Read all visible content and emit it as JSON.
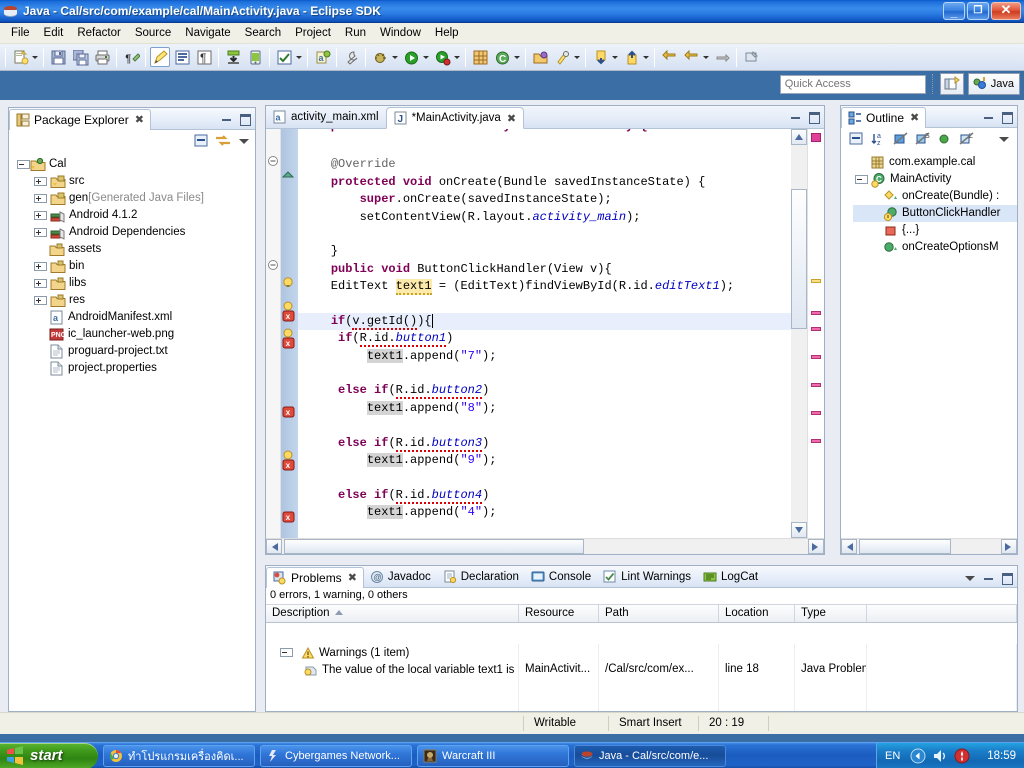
{
  "window": {
    "title": "Java - Cal/src/com/example/cal/MainActivity.java - Eclipse SDK",
    "app_icon": "eclipse-icon",
    "minimize_glyph": "_",
    "maximize_glyph": "❐",
    "close_glyph": "✕"
  },
  "menu": {
    "items": [
      "File",
      "Edit",
      "Refactor",
      "Source",
      "Navigate",
      "Search",
      "Project",
      "Run",
      "Window",
      "Help"
    ]
  },
  "toolbar": {
    "icons": [
      "new-wizard-icon",
      "save-icon",
      "save-all-icon",
      "print-icon",
      "annotation-icon",
      "edit-pencil-icon",
      "toggle-block-selection-icon",
      "show-whitespace-icon",
      "android-sdk-manager-icon",
      "android-avd-manager-icon",
      "lint-check-icon",
      "new-android-project-icon",
      "external-tools-icon",
      "debug-icon",
      "run-icon",
      "coverage-icon",
      "new-java-package-icon",
      "new-java-class-icon",
      "open-type-icon",
      "search-icon",
      "next-annotation-icon",
      "previous-annotation-icon",
      "last-edit-location-icon",
      "back-icon",
      "forward-icon",
      "pin-editor-icon"
    ]
  },
  "quick_access": {
    "placeholder": "Quick Access",
    "value": "",
    "new-perspective-icon": "new-perspective-icon",
    "perspective_label": "Java",
    "perspective_icon": "java-perspective-icon"
  },
  "package_explorer": {
    "title": "Package Explorer",
    "close_glyph": "✖",
    "toolbar_icons": [
      "collapse-all-icon",
      "link-with-editor-icon",
      "view-menu-icon"
    ],
    "tree": [
      {
        "label": "Cal",
        "icon": "java-project-icon",
        "toggle": "minus",
        "depth": 0,
        "dim": ""
      },
      {
        "label": "src",
        "icon": "source-folder-icon",
        "toggle": "plus",
        "depth": 1,
        "dim": ""
      },
      {
        "label": "gen",
        "icon": "source-folder-icon",
        "toggle": "plus",
        "depth": 1,
        "dim": " [Generated Java Files]"
      },
      {
        "label": "Android 4.1.2",
        "icon": "library-icon",
        "toggle": "plus",
        "depth": 1,
        "dim": ""
      },
      {
        "label": "Android Dependencies",
        "icon": "library-icon",
        "toggle": "plus",
        "depth": 1,
        "dim": ""
      },
      {
        "label": "assets",
        "icon": "folder-icon",
        "toggle": "none",
        "depth": 1,
        "dim": ""
      },
      {
        "label": "bin",
        "icon": "folder-icon",
        "toggle": "plus",
        "depth": 1,
        "dim": ""
      },
      {
        "label": "libs",
        "icon": "folder-icon",
        "toggle": "plus",
        "depth": 1,
        "dim": ""
      },
      {
        "label": "res",
        "icon": "folder-icon",
        "toggle": "plus",
        "depth": 1,
        "dim": ""
      },
      {
        "label": "AndroidManifest.xml",
        "icon": "xml-file-icon",
        "toggle": "none",
        "depth": 1,
        "dim": ""
      },
      {
        "label": "ic_launcher-web.png",
        "icon": "png-file-icon",
        "toggle": "none",
        "depth": 1,
        "dim": ""
      },
      {
        "label": "proguard-project.txt",
        "icon": "text-file-icon",
        "toggle": "none",
        "depth": 1,
        "dim": ""
      },
      {
        "label": "project.properties",
        "icon": "text-file-icon",
        "toggle": "none",
        "depth": 1,
        "dim": ""
      }
    ]
  },
  "editor": {
    "tabs": [
      {
        "label": "activity_main.xml",
        "icon": "android-xml-icon",
        "active": false,
        "dirty": false
      },
      {
        "label": "*MainActivity.java",
        "icon": "java-file-icon",
        "active": true,
        "dirty": true
      }
    ],
    "close_glyph": "✖",
    "lines": [
      {
        "text": "    public class MainActivity extends Activity {",
        "clipped": true
      },
      {
        "text": ""
      },
      {
        "text": "        @Override"
      },
      {
        "text": "        protected void onCreate(Bundle savedInstanceState) {"
      },
      {
        "text": "            super.onCreate(savedInstanceState);"
      },
      {
        "text": "            setContentView(R.layout.activity_main);"
      },
      {
        "text": ""
      },
      {
        "text": "        }"
      },
      {
        "text": "        public void ButtonClickHandler(View v){"
      },
      {
        "text": "        EditText text1 = (EditText)findViewById(R.id.editText1);"
      },
      {
        "text": ""
      },
      {
        "text": "        if(v.getId()){",
        "highlight": true
      },
      {
        "text": "         if(R.id.button1)"
      },
      {
        "text": "             text1.append(\"7\");"
      },
      {
        "text": ""
      },
      {
        "text": "         else if(R.id.button2)"
      },
      {
        "text": "             text1.append(\"8\");"
      },
      {
        "text": ""
      },
      {
        "text": "         else if(R.id.button3)"
      },
      {
        "text": "             text1.append(\"9\");"
      },
      {
        "text": ""
      },
      {
        "text": "         else if(R.id.button4)"
      },
      {
        "text": "             text1.append(\"4\");"
      }
    ]
  },
  "outline": {
    "title": "Outline",
    "close_glyph": "✖",
    "toolbar_icons": [
      "collapse-all-icon",
      "sort-icon",
      "hide-fields-icon",
      "hide-static-icon",
      "hide-nonpublic-icon",
      "hide-local-types-icon",
      "view-menu-icon"
    ],
    "tree": [
      {
        "label": "com.example.cal",
        "icon": "package-icon",
        "toggle": "none",
        "depth": 0,
        "sel": false
      },
      {
        "label": "MainActivity",
        "icon": "class-icon",
        "toggle": "minus",
        "depth": 0,
        "sel": false
      },
      {
        "label": "onCreate(Bundle) :",
        "icon": "method-protected-icon",
        "toggle": "none",
        "depth": 1,
        "sel": false
      },
      {
        "label": "ButtonClickHandler",
        "icon": "method-warning-icon",
        "toggle": "none",
        "depth": 1,
        "sel": true
      },
      {
        "label": "{...}",
        "icon": "block-icon",
        "toggle": "none",
        "depth": 1,
        "sel": false
      },
      {
        "label": "onCreateOptionsM",
        "icon": "method-public-icon",
        "toggle": "none",
        "depth": 1,
        "sel": false
      }
    ]
  },
  "bottom_panel": {
    "tabs": [
      {
        "label": "Problems",
        "icon": "problems-icon",
        "active": true
      },
      {
        "label": "Javadoc",
        "icon": "javadoc-icon",
        "active": false
      },
      {
        "label": "Declaration",
        "icon": "declaration-icon",
        "active": false
      },
      {
        "label": "Console",
        "icon": "console-icon",
        "active": false
      },
      {
        "label": "Lint Warnings",
        "icon": "lint-icon",
        "active": false
      },
      {
        "label": "LogCat",
        "icon": "logcat-icon",
        "active": false
      }
    ],
    "close_glyph": "✖",
    "summary": "0 errors, 1 warning, 0 others",
    "columns": [
      "Description",
      "Resource",
      "Path",
      "Location",
      "Type"
    ],
    "sort_column": "Description",
    "rows": [
      {
        "group": true,
        "toggle": "minus",
        "icon": "warning-icon",
        "description": "Warnings (1 item)",
        "resource": "",
        "path": "",
        "location": "",
        "type": ""
      },
      {
        "group": false,
        "icon": "warning-small-icon",
        "description": "The value of the local variable text1 is ",
        "resource": "MainActivit...",
        "path": "/Cal/src/com/ex...",
        "location": "line 18",
        "type": "Java Problem"
      }
    ]
  },
  "statusbar": {
    "writable": "Writable",
    "insert_mode": "Smart Insert",
    "position": "20 : 19"
  },
  "taskbar": {
    "start_label": "start",
    "start_icon": "windows-flag-icon",
    "tasks": [
      {
        "label": "ทำโปรแกรมเครื่องคิดเ...",
        "icon": "chrome-icon",
        "active": false
      },
      {
        "label": "Cybergames Network...",
        "icon": "cybergames-icon",
        "active": false
      },
      {
        "label": "Warcraft III",
        "icon": "warcraft-icon",
        "active": false
      },
      {
        "label": "Java - Cal/src/com/e...",
        "icon": "eclipse-icon",
        "active": true
      }
    ],
    "tray": {
      "language": "EN",
      "icons": [
        "show-hidden-icon",
        "volume-icon",
        "antivirus-icon"
      ],
      "clock": "18:59"
    }
  },
  "colors": {
    "titlebar_blue": "#1c6fdc",
    "keyword_purple": "#7f0055",
    "string_blue": "#2a00ff",
    "field_blue": "#0000c0",
    "error_red": "#d00000",
    "warning_yellow": "#c9a227",
    "selection_blue": "#d9e6f7"
  }
}
